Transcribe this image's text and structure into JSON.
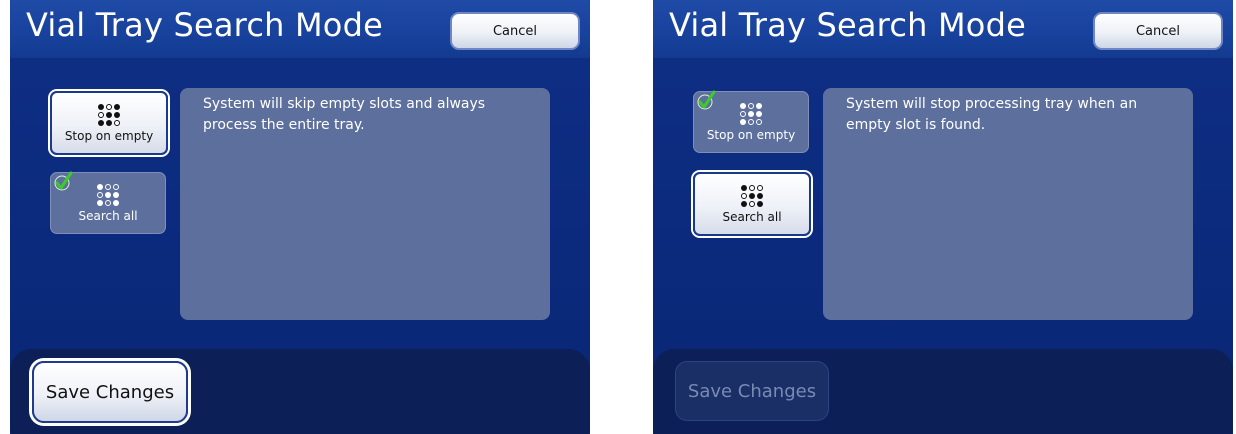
{
  "screens": [
    {
      "title": "Vial Tray Search Mode",
      "cancel_label": "Cancel",
      "description": "System will skip empty slots and always process the entire tray.",
      "options": [
        {
          "label": "Stop on empty",
          "selected": false,
          "icon": "grid-stop-icon"
        },
        {
          "label": "Search all",
          "selected": true,
          "icon": "grid-search-icon"
        }
      ],
      "save_label": "Save Changes",
      "save_enabled": true,
      "checkmark_icon": "checkmark-icon"
    },
    {
      "title": "Vial Tray Search Mode",
      "cancel_label": "Cancel",
      "description": "System will stop processing tray when an empty slot is found.",
      "options": [
        {
          "label": "Stop on empty",
          "selected": true,
          "icon": "grid-stop-icon"
        },
        {
          "label": "Search all",
          "selected": false,
          "icon": "grid-search-icon"
        }
      ],
      "save_label": "Save Changes",
      "save_enabled": false,
      "checkmark_icon": "checkmark-icon"
    }
  ],
  "colors": {
    "accent": "#1f4aa6",
    "panel": "#5d6f9c",
    "check_green": "#3ccb2a",
    "background": "#0b2a7c"
  }
}
